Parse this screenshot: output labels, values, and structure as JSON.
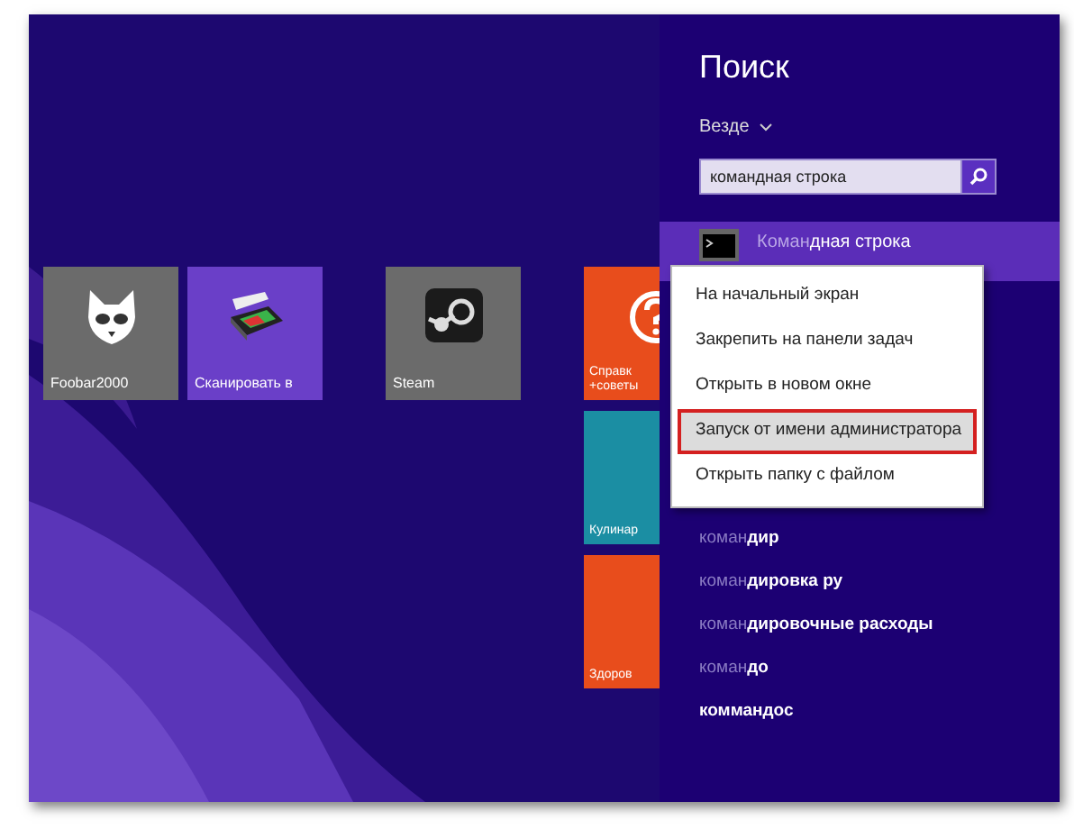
{
  "tiles": [
    {
      "label": "Foobar2000",
      "kind": "foobar",
      "color": "#6b6b6b"
    },
    {
      "label": "Сканировать в",
      "kind": "scanner",
      "color": "#6a3fc8"
    },
    {
      "label": "Steam",
      "kind": "steam",
      "color": "#6b6b6b"
    }
  ],
  "cut_tiles": [
    {
      "lines": [
        "Справк",
        "+советы"
      ],
      "kind": "help",
      "color": "#e84d1c"
    },
    {
      "lines": [
        "Кулинар"
      ],
      "kind": "plain",
      "color": "#1b8ea3"
    },
    {
      "lines": [
        "Здоров"
      ],
      "kind": "plain",
      "color": "#e84d1c"
    }
  ],
  "search": {
    "title": "Поиск",
    "scope": "Везде",
    "value": "командная строка",
    "top_result": {
      "prefix": "Коман",
      "rest": "дная строка"
    },
    "context_menu": [
      {
        "label": "На начальный экран",
        "selected": false
      },
      {
        "label": "Закрепить на панели задач",
        "selected": false
      },
      {
        "label": "Открыть в новом окне",
        "selected": false
      },
      {
        "label": "Запуск от имени администратора",
        "selected": true
      },
      {
        "label": "Открыть папку с файлом",
        "selected": false
      }
    ],
    "suggestions": [
      {
        "prefix": "коман",
        "rest": "дир"
      },
      {
        "prefix": "коман",
        "rest": "дировка ру"
      },
      {
        "prefix": "коман",
        "rest": "дировочные расходы"
      },
      {
        "prefix": "коман",
        "rest": "до"
      },
      {
        "rest": "коммандос"
      }
    ]
  }
}
